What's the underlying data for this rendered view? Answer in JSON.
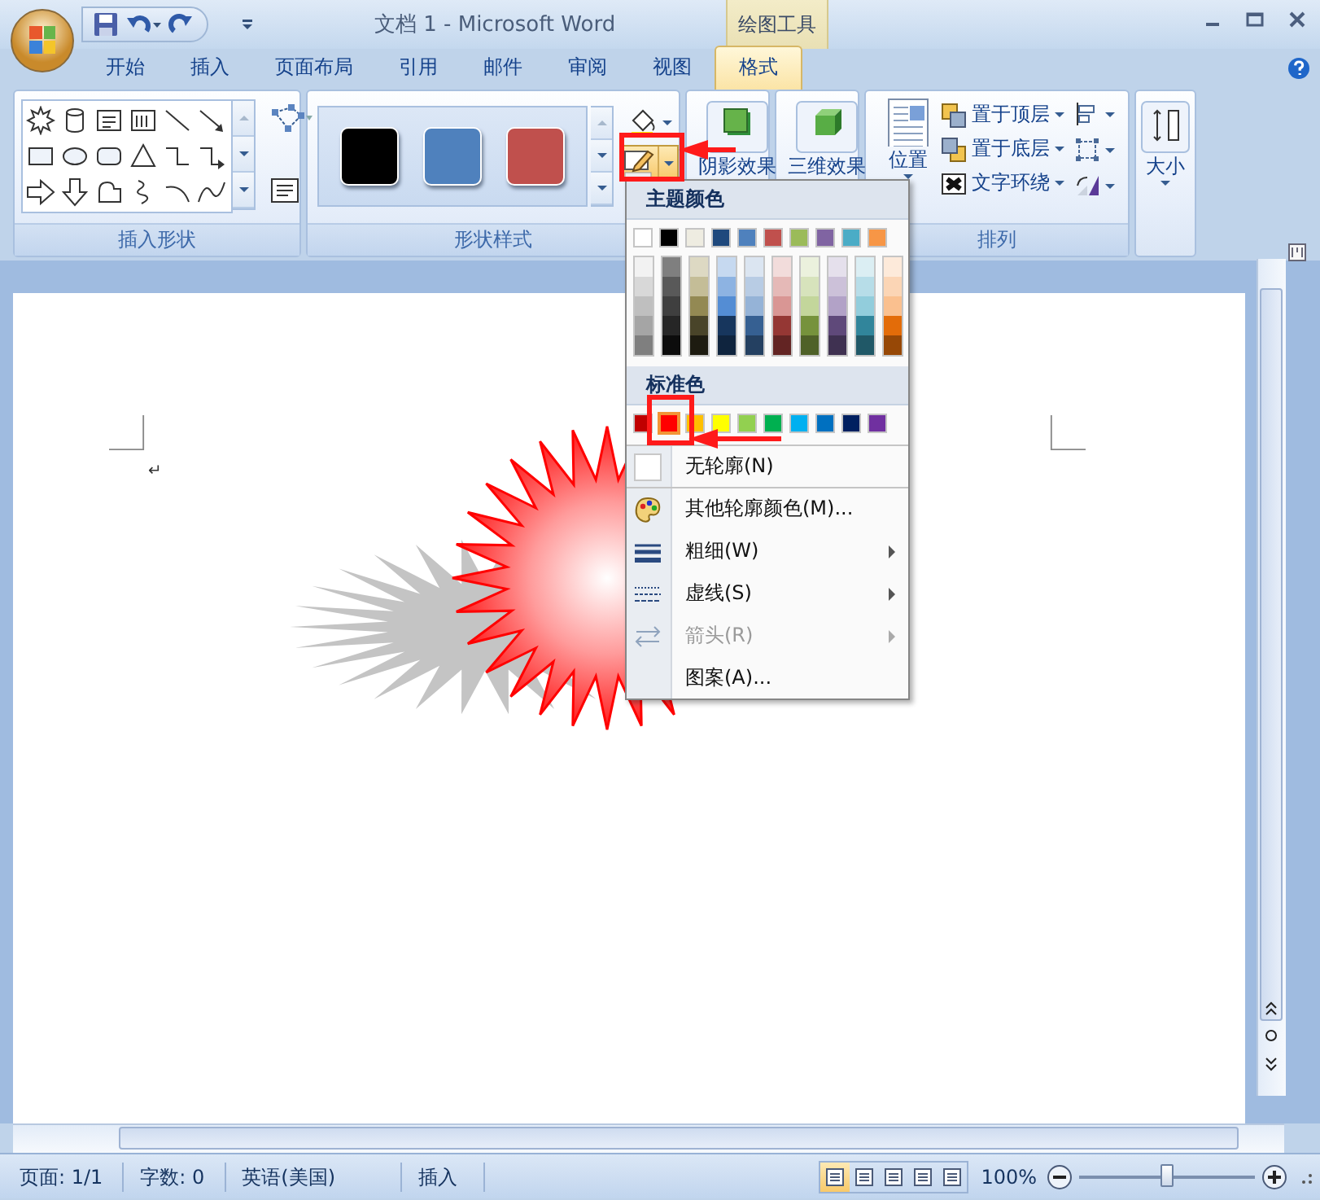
{
  "window": {
    "title": "文档 1 - Microsoft Word",
    "contextual_tab": "绘图工具"
  },
  "tabs": [
    {
      "label": "开始",
      "selected": false
    },
    {
      "label": "插入",
      "selected": false
    },
    {
      "label": "页面布局",
      "selected": false
    },
    {
      "label": "引用",
      "selected": false
    },
    {
      "label": "邮件",
      "selected": false
    },
    {
      "label": "审阅",
      "selected": false
    },
    {
      "label": "视图",
      "selected": false
    },
    {
      "label": "格式",
      "selected": true
    }
  ],
  "insert_shapes": {
    "label": "插入形状"
  },
  "shape_styles": {
    "label": "形状样式",
    "styles": [
      {
        "color": "#000000"
      },
      {
        "color": "#4f81bd"
      },
      {
        "color": "#c0504d"
      }
    ],
    "outline_button": {
      "pressed": true
    }
  },
  "shadow_effects": {
    "label": "阴影效果"
  },
  "three_d_effects": {
    "label": "三维效果"
  },
  "arrange": {
    "label": "排列",
    "position": "位置",
    "commands": [
      "置于顶层",
      "置于底层",
      "文字环绕"
    ]
  },
  "size": {
    "label": "大小"
  },
  "document": {
    "paragraph_mark": "↵"
  },
  "outline_menu": {
    "theme_heading": "主题颜色",
    "theme_colors": [
      {
        "color": "#ffffff",
        "shades": [
          {
            "color": "#f2f2f2"
          },
          {
            "color": "#d8d8d8"
          },
          {
            "color": "#bfbfbf"
          },
          {
            "color": "#a5a5a5"
          },
          {
            "color": "#7f7f7f"
          }
        ]
      },
      {
        "color": "#000000",
        "shades": [
          {
            "color": "#7f7f7f"
          },
          {
            "color": "#595959"
          },
          {
            "color": "#3f3f3f"
          },
          {
            "color": "#262626"
          },
          {
            "color": "#0c0c0c"
          }
        ]
      },
      {
        "color": "#eeece1",
        "shades": [
          {
            "color": "#ddd9c3"
          },
          {
            "color": "#c4bd97"
          },
          {
            "color": "#938953"
          },
          {
            "color": "#494429"
          },
          {
            "color": "#1d1b10"
          }
        ]
      },
      {
        "color": "#1f497d",
        "shades": [
          {
            "color": "#c6d9f0"
          },
          {
            "color": "#8db3e2"
          },
          {
            "color": "#548dd4"
          },
          {
            "color": "#17365d"
          },
          {
            "color": "#0f243e"
          }
        ]
      },
      {
        "color": "#4f81bd",
        "shades": [
          {
            "color": "#dbe5f1"
          },
          {
            "color": "#b8cce4"
          },
          {
            "color": "#95b3d7"
          },
          {
            "color": "#366092"
          },
          {
            "color": "#244061"
          }
        ]
      },
      {
        "color": "#c0504d",
        "shades": [
          {
            "color": "#f2dcdb"
          },
          {
            "color": "#e5b9b7"
          },
          {
            "color": "#d99694"
          },
          {
            "color": "#953734"
          },
          {
            "color": "#632423"
          }
        ]
      },
      {
        "color": "#9bbb59",
        "shades": [
          {
            "color": "#ebf1dd"
          },
          {
            "color": "#d7e3bc"
          },
          {
            "color": "#c3d69b"
          },
          {
            "color": "#76923c"
          },
          {
            "color": "#4f6128"
          }
        ]
      },
      {
        "color": "#8064a2",
        "shades": [
          {
            "color": "#e5e0ec"
          },
          {
            "color": "#ccc1d9"
          },
          {
            "color": "#b2a2c7"
          },
          {
            "color": "#5f497a"
          },
          {
            "color": "#3f3151"
          }
        ]
      },
      {
        "color": "#4bacc6",
        "shades": [
          {
            "color": "#dbeef3"
          },
          {
            "color": "#b7dde8"
          },
          {
            "color": "#92cddc"
          },
          {
            "color": "#31859b"
          },
          {
            "color": "#205867"
          }
        ]
      },
      {
        "color": "#f79646",
        "shades": [
          {
            "color": "#fdeada"
          },
          {
            "color": "#fbd5b5"
          },
          {
            "color": "#fac08f"
          },
          {
            "color": "#e36c09"
          },
          {
            "color": "#974806"
          }
        ]
      }
    ],
    "standard_heading": "标准色",
    "standard_colors": [
      {
        "color": "#c00000",
        "selected": false
      },
      {
        "color": "#ff0000",
        "selected": true
      },
      {
        "color": "#ffc000",
        "selected": false
      },
      {
        "color": "#ffff00",
        "selected": false
      },
      {
        "color": "#92d050",
        "selected": false
      },
      {
        "color": "#00b050",
        "selected": false
      },
      {
        "color": "#00b0f0",
        "selected": false
      },
      {
        "color": "#0070c0",
        "selected": false
      },
      {
        "color": "#002060",
        "selected": false
      },
      {
        "color": "#7030a0",
        "selected": false
      }
    ],
    "items": [
      {
        "kind": "none",
        "label": "无轮廓(N)",
        "submenu": false,
        "disabled": false
      },
      {
        "kind": "more",
        "label": "其他轮廓颜色(M)...",
        "submenu": false,
        "disabled": false
      },
      {
        "kind": "weight",
        "label": "粗细(W)",
        "submenu": true,
        "disabled": false
      },
      {
        "kind": "dash",
        "label": "虚线(S)",
        "submenu": true,
        "disabled": false
      },
      {
        "kind": "arrow",
        "label": "箭头(R)",
        "submenu": true,
        "disabled": true
      },
      {
        "kind": "pattern",
        "label": "图案(A)...",
        "submenu": false,
        "disabled": false
      }
    ]
  },
  "status_bar": {
    "page": "页面: 1/1",
    "words": "字数: 0",
    "language": "英语(美国)",
    "mode": "插入",
    "views": [
      {
        "selected": true
      },
      {
        "selected": false
      },
      {
        "selected": false
      },
      {
        "selected": false
      },
      {
        "selected": false
      }
    ],
    "zoom": "100%",
    "zoom_slider": {
      "level": 0.5
    }
  }
}
